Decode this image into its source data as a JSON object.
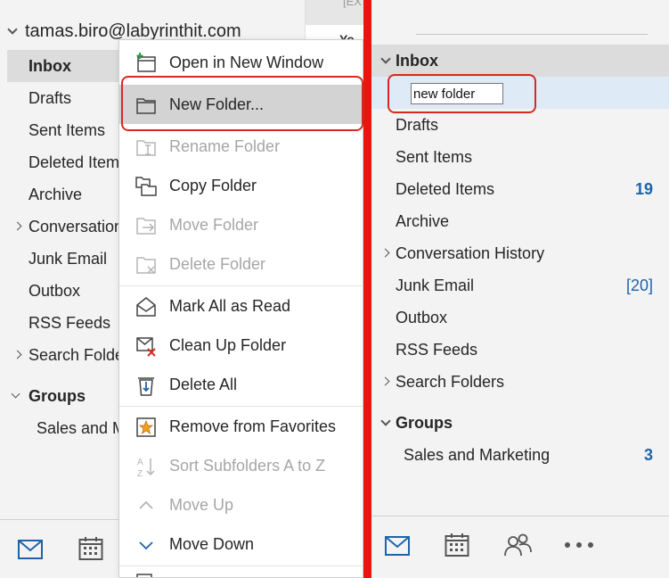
{
  "left_pane": {
    "account": "tamas.biro@labyrinthit.com",
    "strip_text_top": "[EX",
    "strip_text_second": "Yo",
    "folders": [
      {
        "label": "Inbox"
      },
      {
        "label": "Drafts"
      },
      {
        "label": "Sent Items"
      },
      {
        "label": "Deleted Item"
      },
      {
        "label": "Archive"
      },
      {
        "label": "Conversation"
      },
      {
        "label": "Junk Email"
      },
      {
        "label": "Outbox"
      },
      {
        "label": "RSS Feeds"
      },
      {
        "label": "Search Folde"
      }
    ],
    "groups_label": "Groups",
    "group_item": "Sales and M",
    "bottom_icons": [
      "mail-icon",
      "calendar-icon"
    ]
  },
  "context_menu": {
    "items": [
      {
        "label": "Open in New Window",
        "icon": "open-window-icon",
        "enabled": true
      },
      {
        "label": "New Folder...",
        "icon": "new-folder-icon",
        "enabled": true,
        "highlighted": true
      },
      {
        "label": "Rename Folder",
        "icon": "rename-folder-icon",
        "enabled": false
      },
      {
        "label": "Copy Folder",
        "icon": "copy-folder-icon",
        "enabled": true
      },
      {
        "label": "Move Folder",
        "icon": "move-folder-icon",
        "enabled": false
      },
      {
        "label": "Delete Folder",
        "icon": "delete-folder-icon",
        "enabled": false
      },
      {
        "label": "Mark All as Read",
        "icon": "mark-read-icon",
        "enabled": true
      },
      {
        "label": "Clean Up Folder",
        "icon": "clean-up-icon",
        "enabled": true
      },
      {
        "label": "Delete All",
        "icon": "delete-all-icon",
        "enabled": true
      },
      {
        "label": "Remove from Favorites",
        "icon": "favorites-star-icon",
        "enabled": true
      },
      {
        "label": "Sort Subfolders A to Z",
        "icon": "sort-az-icon",
        "enabled": false
      },
      {
        "label": "Move Up",
        "icon": "chevron-up-icon",
        "enabled": false
      },
      {
        "label": "Move Down",
        "icon": "chevron-down-icon",
        "enabled": true
      }
    ]
  },
  "right_pane": {
    "inbox_label": "Inbox",
    "new_folder_value": "new folder",
    "folders": [
      {
        "label": "Drafts",
        "count": ""
      },
      {
        "label": "Sent Items",
        "count": ""
      },
      {
        "label": "Deleted Items",
        "count": "19"
      },
      {
        "label": "Archive",
        "count": ""
      },
      {
        "label": "Conversation History",
        "count": ""
      },
      {
        "label": "Junk Email",
        "count": "[20]"
      },
      {
        "label": "Outbox",
        "count": ""
      },
      {
        "label": "RSS Feeds",
        "count": ""
      },
      {
        "label": "Search Folders",
        "count": ""
      }
    ],
    "groups_label": "Groups",
    "group_item": {
      "label": "Sales and Marketing",
      "count": "3"
    },
    "bottom_icons": [
      "mail-icon",
      "calendar-icon",
      "people-icon",
      "more-icon"
    ]
  },
  "colors": {
    "accent_blue": "#1f63a8",
    "annotation_red": "#d62a20",
    "divider_red": "#e8170d"
  }
}
